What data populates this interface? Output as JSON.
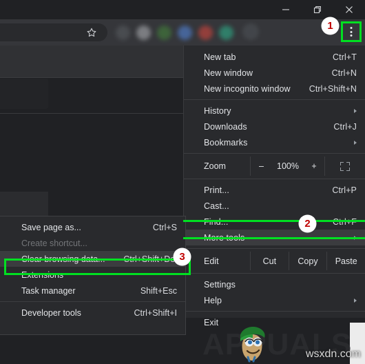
{
  "window": {
    "controls": [
      {
        "name": "minimize",
        "glyph": "minimize-icon"
      },
      {
        "name": "restore",
        "glyph": "restore-icon"
      },
      {
        "name": "close",
        "glyph": "close-icon"
      }
    ]
  },
  "toolbar": {
    "bookmark_icon": "star-icon",
    "menu_button": "three-dot-menu-icon",
    "extension_colors": [
      "#4e5155",
      "#8b8d91",
      "#3f6d3a",
      "#4a6fae",
      "#a8413c",
      "#2f8f74"
    ]
  },
  "menu": {
    "items": [
      {
        "label": "New tab",
        "accel": "Ctrl+T"
      },
      {
        "label": "New window",
        "accel": "Ctrl+N"
      },
      {
        "label": "New incognito window",
        "accel": "Ctrl+Shift+N"
      },
      {
        "label": "History",
        "accel": "",
        "submenu": true
      },
      {
        "label": "Downloads",
        "accel": "Ctrl+J"
      },
      {
        "label": "Bookmarks",
        "accel": "",
        "submenu": true
      },
      {
        "label": "Print...",
        "accel": "Ctrl+P"
      },
      {
        "label": "Cast...",
        "accel": ""
      },
      {
        "label": "Find...",
        "accel": "Ctrl+F"
      },
      {
        "label": "More tools",
        "accel": "",
        "submenu": true
      },
      {
        "label": "Settings",
        "accel": ""
      },
      {
        "label": "Help",
        "accel": "",
        "submenu": true
      },
      {
        "label": "Exit",
        "accel": ""
      }
    ],
    "zoom_row": {
      "label": "Zoom",
      "minus": "–",
      "value": "100%",
      "plus": "+",
      "fullscreen_icon": "fullscreen-icon"
    },
    "edit_row": {
      "label": "Edit",
      "cut": "Cut",
      "copy": "Copy",
      "paste": "Paste"
    }
  },
  "submenu": {
    "items": [
      {
        "label": "Save page as...",
        "accel": "Ctrl+S",
        "state": "normal"
      },
      {
        "label": "Create shortcut...",
        "accel": "",
        "state": "disabled"
      },
      {
        "label": "Clear browsing data...",
        "accel": "Ctrl+Shift+Del",
        "state": "active"
      },
      {
        "label": "Extensions",
        "accel": "",
        "state": "normal"
      },
      {
        "label": "Task manager",
        "accel": "Shift+Esc",
        "state": "normal"
      },
      {
        "label": "Developer tools",
        "accel": "Ctrl+Shift+I",
        "state": "normal"
      }
    ]
  },
  "annotations": {
    "highlight_color": "#00e021",
    "badge_color": "#c00000",
    "steps": [
      {
        "number": "1",
        "target": "three-dot-menu-button"
      },
      {
        "number": "2",
        "target": "more-tools-menu-item"
      },
      {
        "number": "3",
        "target": "clear-browsing-data-menu-item"
      }
    ]
  },
  "watermark": {
    "brand": "APPUALS",
    "site": "wsxdn.com"
  }
}
